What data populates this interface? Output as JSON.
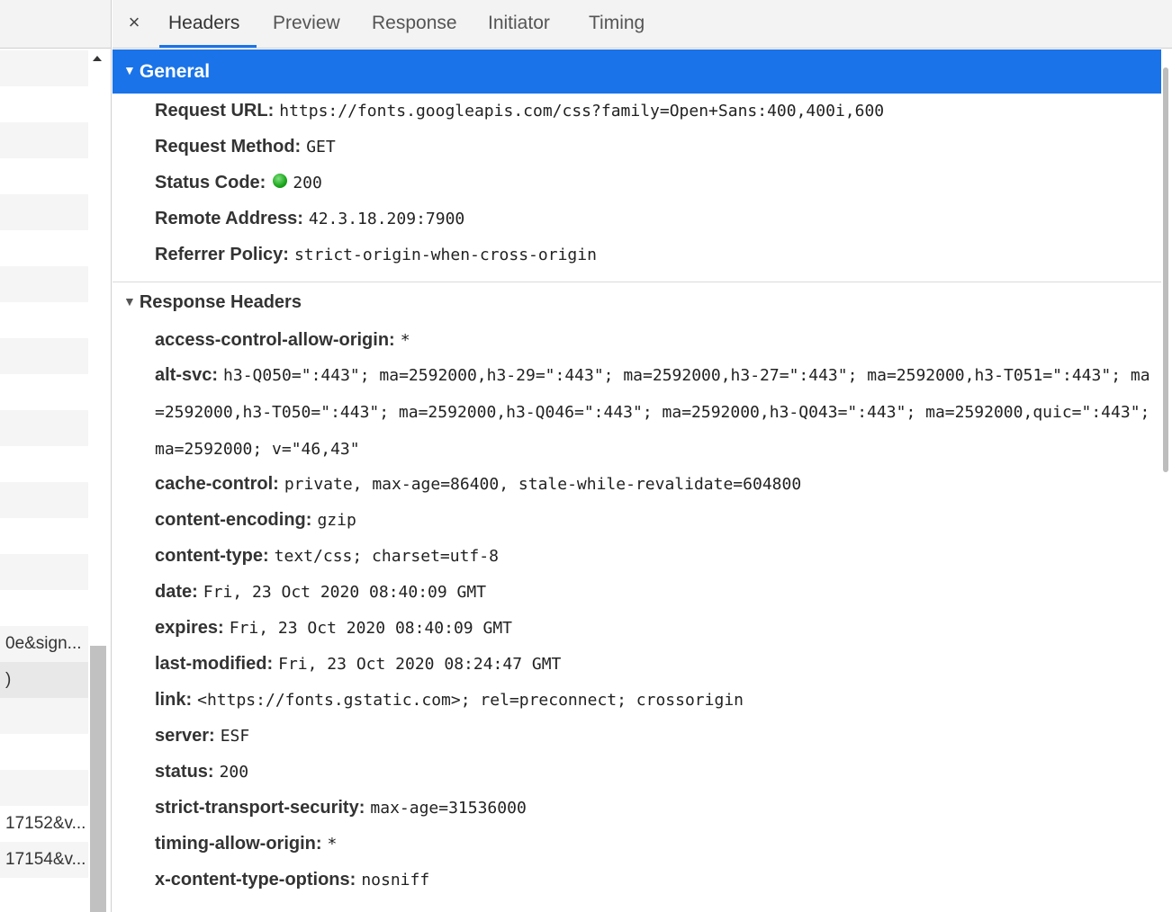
{
  "tabs": {
    "close_glyph": "×",
    "items": [
      "Headers",
      "Preview",
      "Response",
      "Initiator",
      "Timing"
    ],
    "active": "Headers"
  },
  "left_list": {
    "rows": [
      "",
      "",
      "",
      "",
      "",
      "",
      "",
      "",
      "",
      "",
      "",
      "",
      "",
      "",
      "",
      "",
      "0e&sign...",
      ")",
      "",
      "",
      "",
      "17152&v...",
      "17154&v..."
    ]
  },
  "general": {
    "title": "General",
    "request_url_label": "Request URL:",
    "request_url": "https://fonts.googleapis.com/css?family=Open+Sans:400,400i,600",
    "request_method_label": "Request Method:",
    "request_method": "GET",
    "status_code_label": "Status Code:",
    "status_code": "200",
    "status_color": "#1aa51a",
    "remote_address_label": "Remote Address:",
    "remote_address": "42.3.18.209:7900",
    "referrer_policy_label": "Referrer Policy:",
    "referrer_policy": "strict-origin-when-cross-origin"
  },
  "response_headers": {
    "title": "Response Headers",
    "items": [
      {
        "key": "access-control-allow-origin:",
        "value": "*"
      },
      {
        "key": "alt-svc:",
        "value": "h3-Q050=\":443\"; ma=2592000,h3-29=\":443\"; ma=2592000,h3-27=\":443\"; ma=2592000,h3-T051=\":443\"; ma=2592000,h3-T050=\":443\"; ma=2592000,h3-Q046=\":443\"; ma=2592000,h3-Q043=\":443\"; ma=2592000,quic=\":443\"; ma=2592000; v=\"46,43\""
      },
      {
        "key": "cache-control:",
        "value": "private, max-age=86400, stale-while-revalidate=604800"
      },
      {
        "key": "content-encoding:",
        "value": "gzip"
      },
      {
        "key": "content-type:",
        "value": "text/css; charset=utf-8"
      },
      {
        "key": "date:",
        "value": "Fri, 23 Oct 2020 08:40:09 GMT"
      },
      {
        "key": "expires:",
        "value": "Fri, 23 Oct 2020 08:40:09 GMT"
      },
      {
        "key": "last-modified:",
        "value": "Fri, 23 Oct 2020 08:24:47 GMT"
      },
      {
        "key": "link:",
        "value": "<https://fonts.gstatic.com>; rel=preconnect; crossorigin"
      },
      {
        "key": "server:",
        "value": "ESF"
      },
      {
        "key": "status:",
        "value": "200"
      },
      {
        "key": "strict-transport-security:",
        "value": "max-age=31536000"
      },
      {
        "key": "timing-allow-origin:",
        "value": "*"
      },
      {
        "key": "x-content-type-options:",
        "value": "nosniff"
      }
    ]
  },
  "colors": {
    "accent": "#1a73e8"
  }
}
